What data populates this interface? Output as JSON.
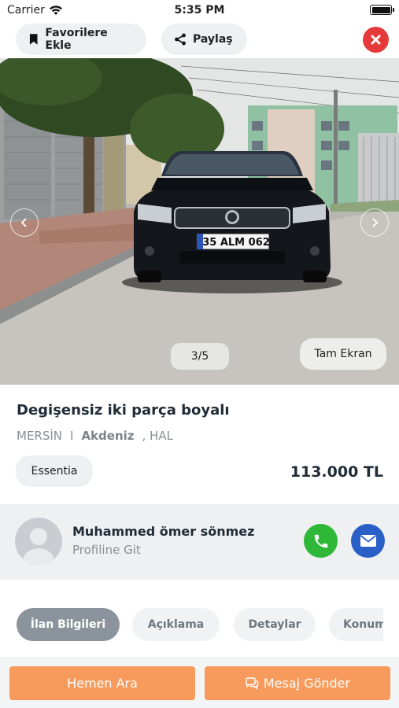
{
  "status_bar": {
    "carrier": "Carrier",
    "time": "5:35 PM"
  },
  "top_bar": {
    "favorite_label": "Favorilere Ekle",
    "share_label": "Paylaş",
    "close_icon": "close-icon"
  },
  "gallery": {
    "plate_text": "35 ALM 062",
    "counter": "3/5",
    "fullscreen_label": "Tam Ekran"
  },
  "listing": {
    "title": "Degişensiz iki parça boyalı",
    "city": "MERSİN",
    "separator": "I",
    "district": "Akdeniz",
    "neighborhood": ", HAL",
    "trim": "Essentia",
    "price": "113.000 TL"
  },
  "seller": {
    "name": "Muhammed ömer sönmez",
    "profile_link": "Profiline Git"
  },
  "tabs": [
    {
      "label": "İlan Bilgileri",
      "active": true
    },
    {
      "label": "Açıklama",
      "active": false
    },
    {
      "label": "Detaylar",
      "active": false
    },
    {
      "label": "Konum",
      "active": false
    }
  ],
  "bottom": {
    "call_label": "Hemen Ara",
    "message_label": "Mesaj Gönder"
  },
  "colors": {
    "accent_orange": "#f79b5c",
    "close_red": "#e63a3a",
    "call_green": "#2fb738",
    "mail_blue": "#2a5fc7",
    "active_tab": "#8b949c"
  }
}
